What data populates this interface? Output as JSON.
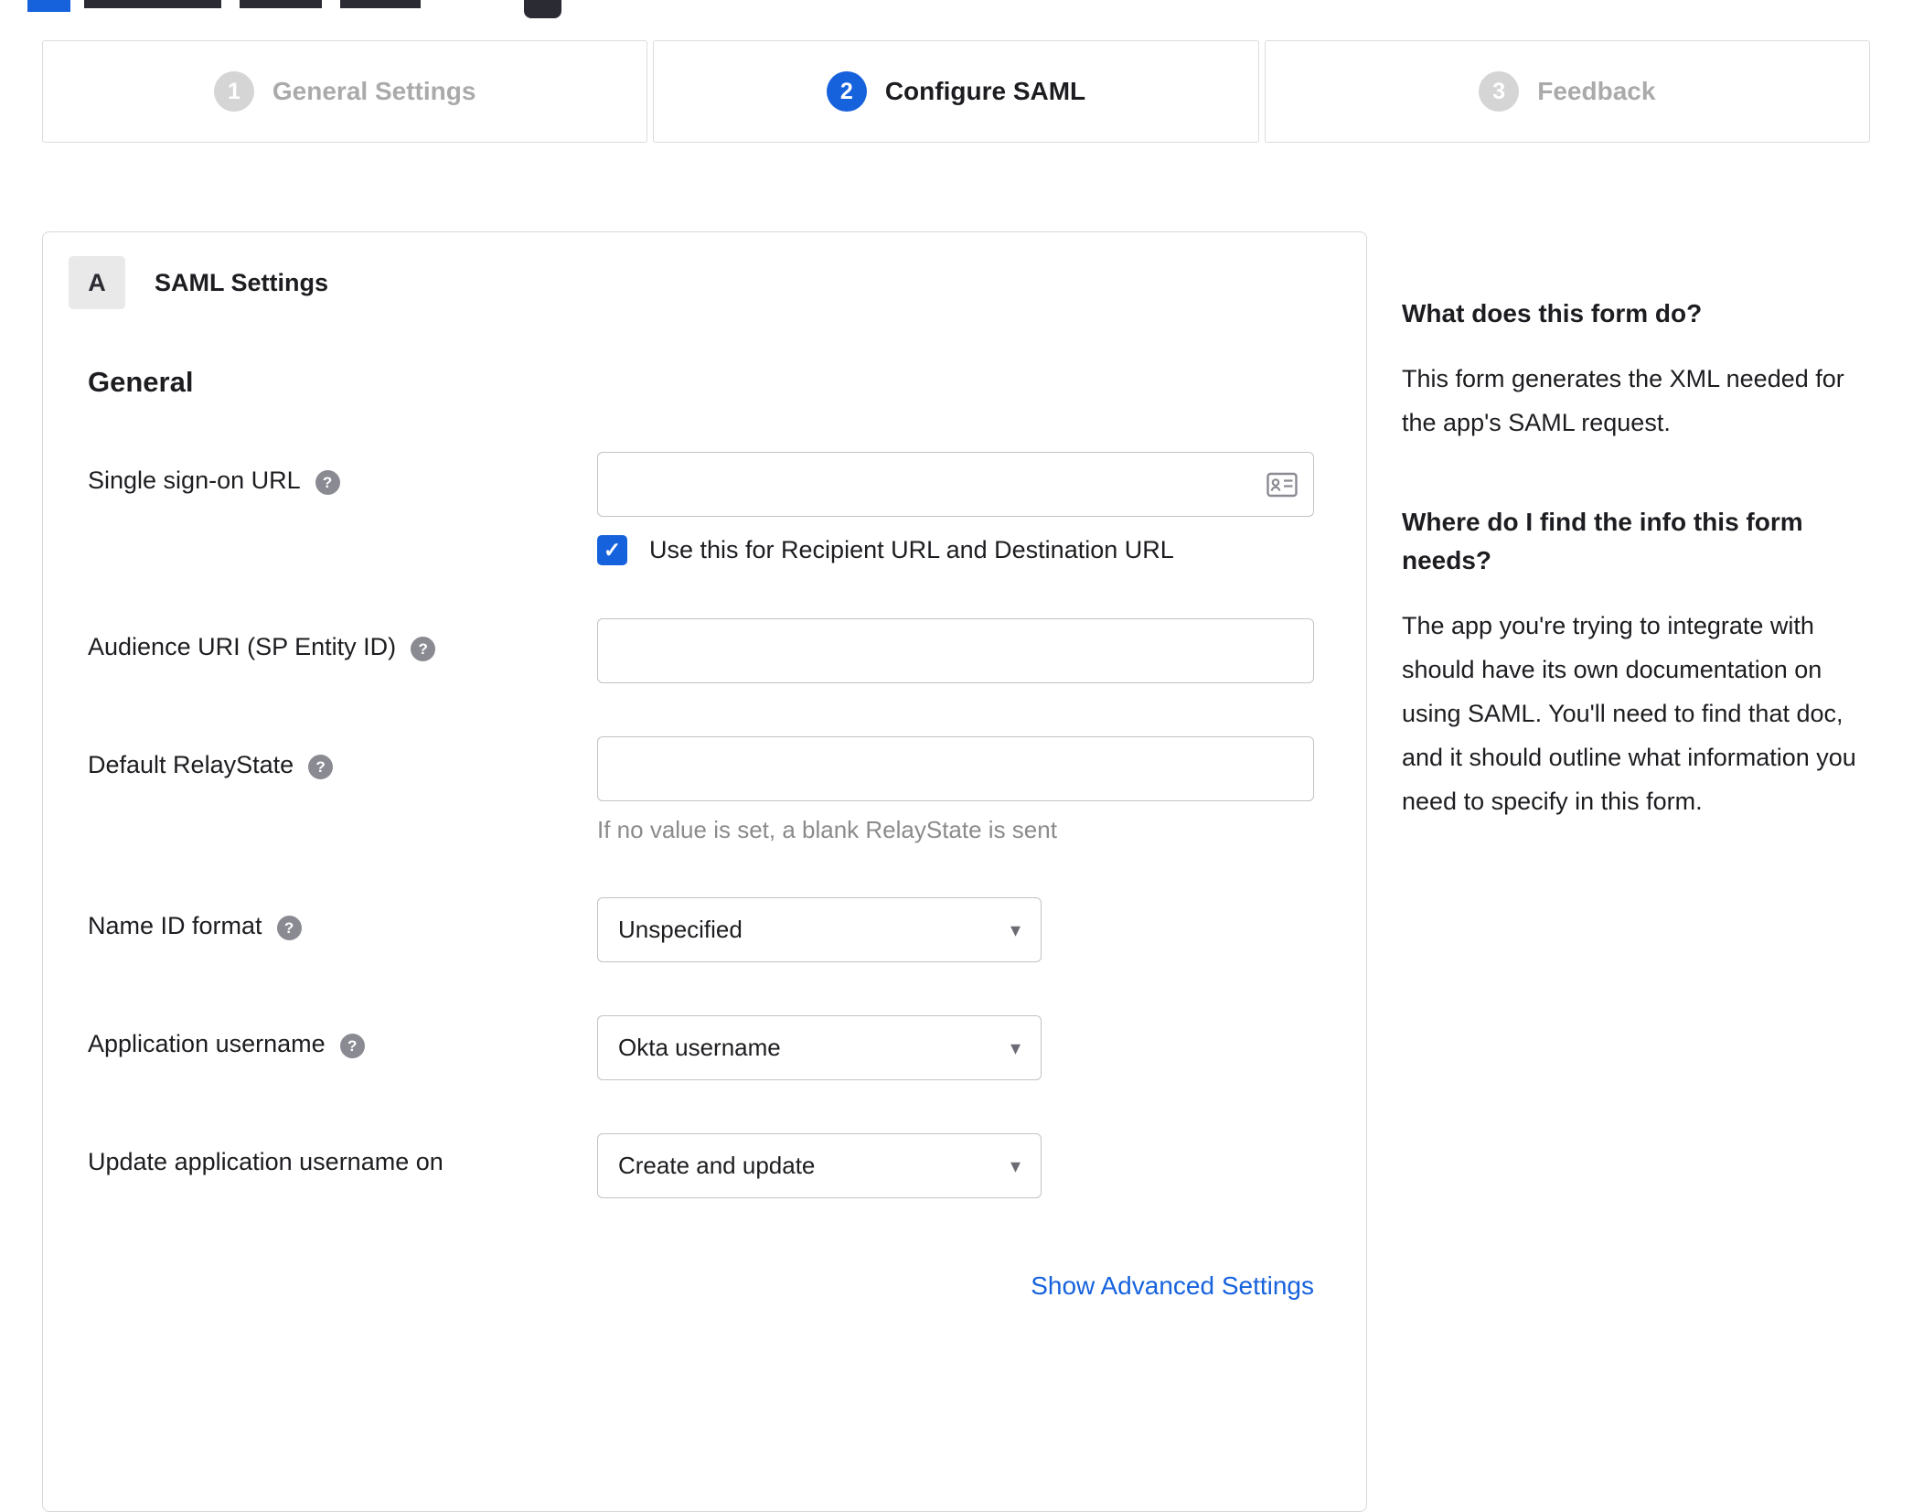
{
  "colors": {
    "accent": "#1662dd",
    "inactive_step_gray": "#d5d5d5",
    "border_gray": "#d8d8d8",
    "hint_gray": "#8b8b8b"
  },
  "stepper": {
    "steps": [
      {
        "number": "1",
        "label": "General Settings",
        "state": "inactive"
      },
      {
        "number": "2",
        "label": "Configure SAML",
        "state": "active"
      },
      {
        "number": "3",
        "label": "Feedback",
        "state": "inactive"
      }
    ]
  },
  "panel": {
    "section_badge": "A",
    "section_title": "SAML Settings",
    "group_title": "General",
    "fields": {
      "sso_url": {
        "label": "Single sign-on URL",
        "value": "",
        "checkbox_label": "Use this for Recipient URL and Destination URL",
        "checkbox_checked": true
      },
      "audience_uri": {
        "label": "Audience URI (SP Entity ID)",
        "value": ""
      },
      "relay_state": {
        "label": "Default RelayState",
        "value": "",
        "hint": "If no value is set, a blank RelayState is sent"
      },
      "name_id_format": {
        "label": "Name ID format",
        "value": "Unspecified"
      },
      "app_username": {
        "label": "Application username",
        "value": "Okta username"
      },
      "update_app_username": {
        "label": "Update application username on",
        "value": "Create and update"
      }
    },
    "advanced_link": "Show Advanced Settings"
  },
  "sidebar": {
    "sections": [
      {
        "heading": "What does this form do?",
        "body": "This form generates the XML needed for the app's SAML request."
      },
      {
        "heading": "Where do I find the info this form needs?",
        "body": "The app you're trying to integrate with should have its own documentation on using SAML. You'll need to find that doc, and it should outline what information you need to specify in this form."
      }
    ]
  }
}
